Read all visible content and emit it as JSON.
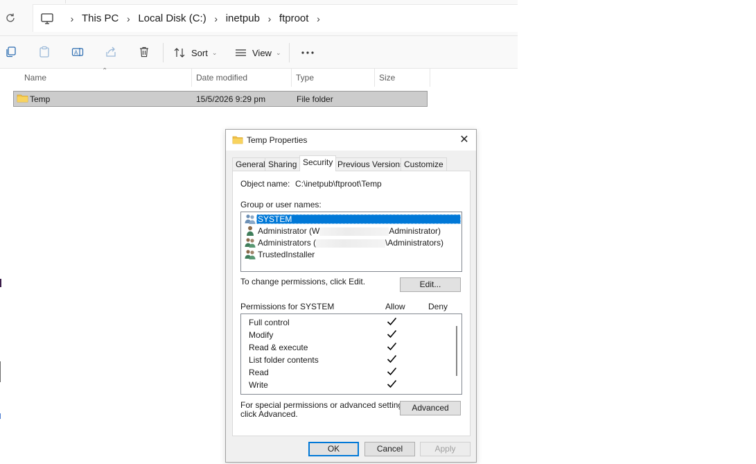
{
  "explorer": {
    "breadcrumbs": [
      "This PC",
      "Local Disk (C:)",
      "inetpub",
      "ftproot"
    ],
    "toolbar": {
      "sort_label": "Sort",
      "view_label": "View"
    },
    "columns": [
      "Name",
      "Date modified",
      "Type",
      "Size"
    ],
    "rows": [
      {
        "name": "Temp",
        "date": "15/5/2026 9:29 pm",
        "type": "File folder",
        "size": ""
      }
    ]
  },
  "dialog": {
    "title": "Temp Properties",
    "tabs": [
      "General",
      "Sharing",
      "Security",
      "Previous Versions",
      "Customize"
    ],
    "active_tab": "Security",
    "object_name_label": "Object name:",
    "object_name_value": "C:\\inetpub\\ftproot\\Temp",
    "group_label": "Group or user names:",
    "users": [
      {
        "name": "SYSTEM",
        "selected": true
      },
      {
        "name_prefix": "Administrator (W",
        "name_suffix": "Administrator)"
      },
      {
        "name_prefix": "Administrators (",
        "name_suffix": "\\Administrators)"
      },
      {
        "name": "TrustedInstaller"
      }
    ],
    "change_perm_text": "To change permissions, click Edit.",
    "edit_button": "Edit...",
    "permissions_for": "Permissions for SYSTEM",
    "allow_header": "Allow",
    "deny_header": "Deny",
    "permissions": [
      {
        "name": "Full control",
        "allow": true,
        "deny": false
      },
      {
        "name": "Modify",
        "allow": true,
        "deny": false
      },
      {
        "name": "Read & execute",
        "allow": true,
        "deny": false
      },
      {
        "name": "List folder contents",
        "allow": true,
        "deny": false
      },
      {
        "name": "Read",
        "allow": true,
        "deny": false
      },
      {
        "name": "Write",
        "allow": true,
        "deny": false
      }
    ],
    "special_text_1": "For special permissions or advanced settings,",
    "special_text_2": "click Advanced.",
    "advanced_button": "Advanced",
    "ok_button": "OK",
    "cancel_button": "Cancel",
    "apply_button": "Apply",
    "accent_color": "#0078d7"
  }
}
